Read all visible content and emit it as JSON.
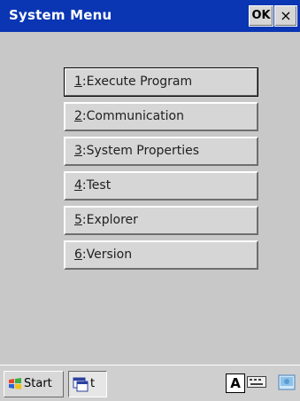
{
  "window": {
    "title": "System Menu",
    "ok_label": "OK",
    "close_label": "×"
  },
  "menu": {
    "items": [
      {
        "hotkey": "1",
        "rest": ":Execute Program",
        "selected": true
      },
      {
        "hotkey": "2",
        "rest": ":Communication",
        "selected": false
      },
      {
        "hotkey": "3",
        "rest": ":System Properties",
        "selected": false
      },
      {
        "hotkey": "4",
        "rest": ":Test",
        "selected": false
      },
      {
        "hotkey": "5",
        "rest": ":Explorer",
        "selected": false
      },
      {
        "hotkey": "6",
        "rest": ":Version",
        "selected": false
      }
    ]
  },
  "taskbar": {
    "start_label": "Start",
    "task_label": "t",
    "input_mode_label": "A",
    "icons": {
      "start": "windows-flag-icon",
      "task": "application-window-icon",
      "keyboard": "keyboard-icon",
      "desktop": "show-desktop-icon"
    }
  },
  "colors": {
    "titlebar": "#0a36b4",
    "background": "#c8c8c8",
    "button_face": "#d6d6d6"
  }
}
